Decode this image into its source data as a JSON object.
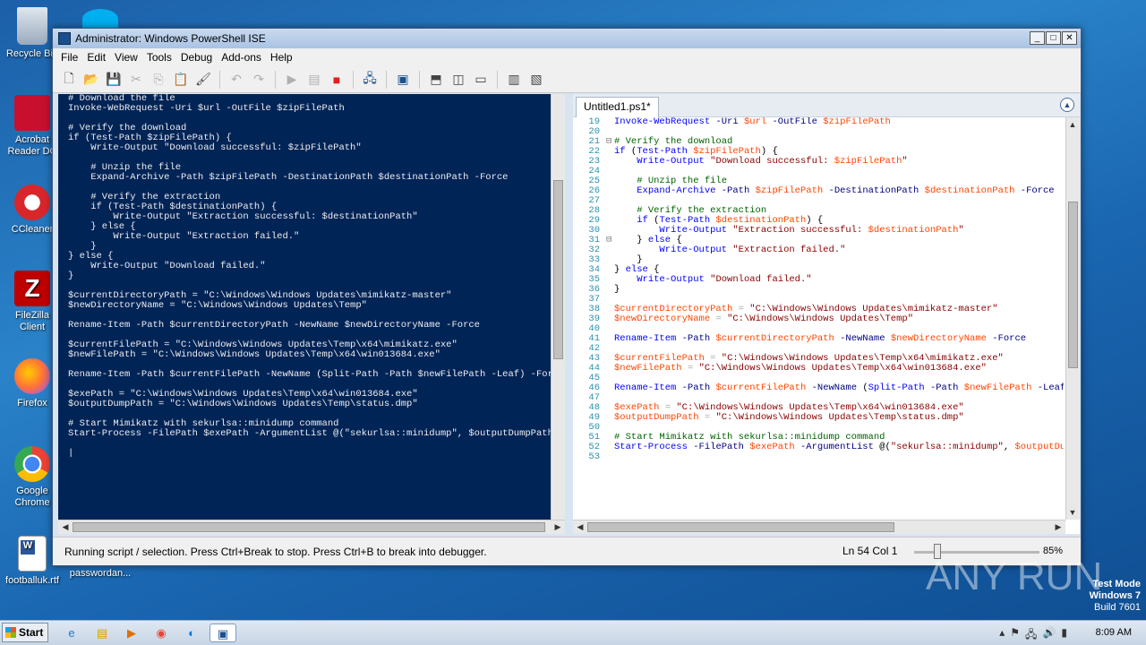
{
  "desktop": {
    "icons": [
      {
        "label": "Recycle Bin"
      },
      {
        "label": "Acrobat Reader DC"
      },
      {
        "label": "CCleaner"
      },
      {
        "label": "FileZilla Client"
      },
      {
        "label": "Firefox"
      },
      {
        "label": "Google Chrome"
      },
      {
        "label": "footballuk.rtf"
      },
      {
        "label": "passwordan..."
      }
    ],
    "watermark": "ANY RUN",
    "test_mode": {
      "line1": "Test Mode",
      "line2": "Windows 7",
      "line3": "Build 7601"
    }
  },
  "window": {
    "title": "Administrator: Windows PowerShell ISE",
    "menu": [
      "File",
      "Edit",
      "View",
      "Tools",
      "Debug",
      "Add-ons",
      "Help"
    ]
  },
  "editor": {
    "tab_label": "Untitled1.ps1*"
  },
  "statusbar": {
    "message": "Running script / selection.  Press Ctrl+Break to stop.  Press Ctrl+B to break into debugger.",
    "position": "Ln 54  Col 1",
    "zoom": "85%"
  },
  "taskbar": {
    "start_label": "Start",
    "clock": "8:09 AM"
  },
  "colors": {
    "console_bg": "#012456",
    "accent": "#1b4f8c"
  }
}
